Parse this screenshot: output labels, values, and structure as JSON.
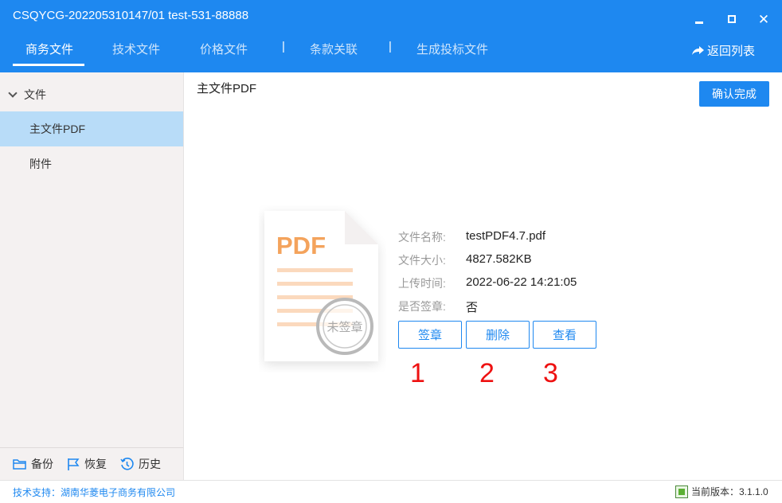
{
  "window": {
    "title": "CSQYCG-202205310147/01 test-531-88888",
    "minimize_icon": "minimize-icon",
    "maximize_icon": "maximize-icon",
    "close_icon": "close-icon"
  },
  "tabs": [
    {
      "label": "商务文件",
      "active": true
    },
    {
      "label": "技术文件",
      "active": false
    },
    {
      "label": "价格文件",
      "active": false
    },
    {
      "label": "条款关联",
      "active": false
    },
    {
      "label": "生成投标文件",
      "active": false
    }
  ],
  "separator": "|",
  "back_link": {
    "label": "返回列表",
    "icon": "share-arrow-icon"
  },
  "sidebar": {
    "root_label": "文件",
    "items": [
      {
        "label": "主文件PDF",
        "active": true
      },
      {
        "label": "附件",
        "active": false
      }
    ],
    "footer": [
      {
        "label": "备份",
        "icon": "folder-icon"
      },
      {
        "label": "恢复",
        "icon": "flag-icon"
      },
      {
        "label": "历史",
        "icon": "history-icon"
      }
    ]
  },
  "main": {
    "title": "主文件PDF",
    "confirm_label": "确认完成",
    "pdf_badge": "PDF",
    "stamp_text": "未签章",
    "info": [
      {
        "label": "文件名称:",
        "value": "testPDF4.7.pdf"
      },
      {
        "label": "文件大小:",
        "value": "4827.582KB"
      },
      {
        "label": "上传时间:",
        "value": "2022-06-22 14:21:05"
      },
      {
        "label": "是否签章:",
        "value": "否"
      }
    ],
    "actions": [
      {
        "label": "签章"
      },
      {
        "label": "删除"
      },
      {
        "label": "查看"
      }
    ],
    "annotations": [
      "1",
      "2",
      "3"
    ]
  },
  "status": {
    "support": "技术支持：湖南华菱电子商务有限公司",
    "version": "当前版本：3.1.1.0"
  },
  "colors": {
    "brand": "#1e88f0",
    "pdf_orange": "#f4a35c",
    "annotation_red": "#ee1111"
  }
}
